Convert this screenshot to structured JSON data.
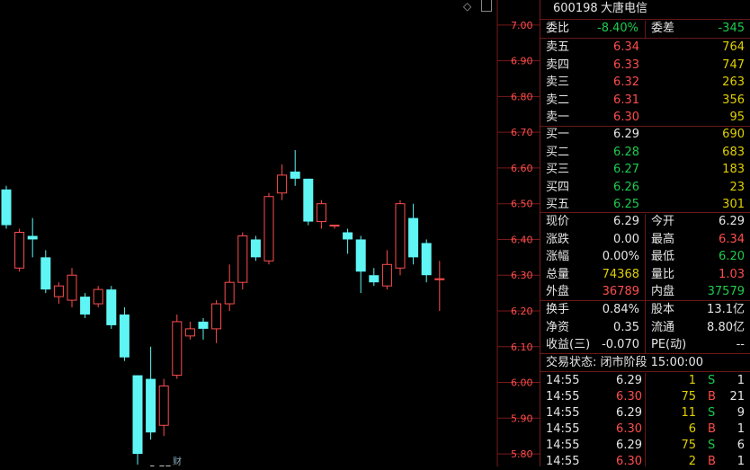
{
  "stock": {
    "code": "600198",
    "name": "大唐电信"
  },
  "ratio": {
    "wb_label": "委比",
    "wb_value": "-8.40%",
    "wc_label": "委差",
    "wc_value": "-345"
  },
  "asks": [
    {
      "label": "卖五",
      "price": "6.34",
      "vol": "764"
    },
    {
      "label": "卖四",
      "price": "6.33",
      "vol": "747"
    },
    {
      "label": "卖三",
      "price": "6.32",
      "vol": "263"
    },
    {
      "label": "卖二",
      "price": "6.31",
      "vol": "356"
    },
    {
      "label": "卖一",
      "price": "6.30",
      "vol": "95"
    }
  ],
  "bids": [
    {
      "label": "买一",
      "price": "6.29",
      "vol": "690"
    },
    {
      "label": "买二",
      "price": "6.28",
      "vol": "683"
    },
    {
      "label": "买三",
      "price": "6.27",
      "vol": "183"
    },
    {
      "label": "买四",
      "price": "6.26",
      "vol": "23"
    },
    {
      "label": "买五",
      "price": "6.25",
      "vol": "301"
    }
  ],
  "quote": [
    {
      "l1": "现价",
      "v1": "6.29",
      "c1": "white",
      "l2": "今开",
      "v2": "6.29",
      "c2": "white"
    },
    {
      "l1": "涨跌",
      "v1": "0.00",
      "c1": "white",
      "l2": "最高",
      "v2": "6.34",
      "c2": "red"
    },
    {
      "l1": "涨幅",
      "v1": "0.00%",
      "c1": "white",
      "l2": "最低",
      "v2": "6.20",
      "c2": "green"
    },
    {
      "l1": "总量",
      "v1": "74368",
      "c1": "yellow",
      "l2": "量比",
      "v2": "1.03",
      "c2": "red"
    },
    {
      "l1": "外盘",
      "v1": "36789",
      "c1": "red",
      "l2": "内盘",
      "v2": "37579",
      "c2": "green"
    }
  ],
  "fund": [
    {
      "l1": "换手",
      "v1": "0.84%",
      "l2": "股本",
      "v2": "13.1亿"
    },
    {
      "l1": "净资",
      "v1": "0.35",
      "l2": "流通",
      "v2": "8.80亿"
    },
    {
      "l1": "收益(三)",
      "v1": "-0.070",
      "l2": "PE(动)",
      "v2": "--"
    }
  ],
  "status": "交易状态: 闭市阶段 15:00:00",
  "ticks": [
    {
      "time": "14:55",
      "price": "6.29",
      "pc": "white",
      "vol": "1",
      "side": "S",
      "count": "1"
    },
    {
      "time": "14:55",
      "price": "6.30",
      "pc": "red",
      "vol": "75",
      "side": "B",
      "count": "21"
    },
    {
      "time": "14:55",
      "price": "6.29",
      "pc": "white",
      "vol": "11",
      "side": "S",
      "count": "9"
    },
    {
      "time": "14:55",
      "price": "6.30",
      "pc": "red",
      "vol": "6",
      "side": "B",
      "count": "1"
    },
    {
      "time": "14:55",
      "price": "6.29",
      "pc": "white",
      "vol": "75",
      "side": "S",
      "count": "6"
    },
    {
      "time": "14:55",
      "price": "6.30",
      "pc": "red",
      "vol": "2",
      "side": "B",
      "count": "1"
    }
  ],
  "chart_data": {
    "type": "candlestick",
    "y_ticks": [
      "7.00",
      "6.90",
      "6.80",
      "6.70",
      "6.60",
      "6.50",
      "6.40",
      "6.30",
      "6.20",
      "6.10",
      "6.00",
      "5.90",
      "5.80"
    ],
    "ylim": [
      5.765,
      7.07
    ],
    "low_annotation": "5.77",
    "bottom_marker": "财",
    "up_color": "#ff4d4d",
    "down_color": "#5ff5f5",
    "candles": [
      {
        "o": 6.54,
        "h": 6.55,
        "l": 6.43,
        "c": 6.44
      },
      {
        "o": 6.32,
        "h": 6.43,
        "l": 6.31,
        "c": 6.42
      },
      {
        "o": 6.41,
        "h": 6.46,
        "l": 6.35,
        "c": 6.4
      },
      {
        "o": 6.35,
        "h": 6.37,
        "l": 6.25,
        "c": 6.26
      },
      {
        "o": 6.24,
        "h": 6.28,
        "l": 6.22,
        "c": 6.27
      },
      {
        "o": 6.23,
        "h": 6.32,
        "l": 6.21,
        "c": 6.3
      },
      {
        "o": 6.24,
        "h": 6.25,
        "l": 6.18,
        "c": 6.19
      },
      {
        "o": 6.22,
        "h": 6.27,
        "l": 6.21,
        "c": 6.26
      },
      {
        "o": 6.26,
        "h": 6.27,
        "l": 6.15,
        "c": 6.16
      },
      {
        "o": 6.19,
        "h": 6.21,
        "l": 6.06,
        "c": 6.07
      },
      {
        "o": 6.02,
        "h": 6.02,
        "l": 5.77,
        "c": 5.8
      },
      {
        "o": 6.01,
        "h": 6.1,
        "l": 5.84,
        "c": 5.86
      },
      {
        "o": 5.88,
        "h": 6.01,
        "l": 5.85,
        "c": 5.99
      },
      {
        "o": 6.02,
        "h": 6.19,
        "l": 6.01,
        "c": 6.17
      },
      {
        "o": 6.13,
        "h": 6.17,
        "l": 6.12,
        "c": 6.15
      },
      {
        "o": 6.17,
        "h": 6.18,
        "l": 6.12,
        "c": 6.15
      },
      {
        "o": 6.15,
        "h": 6.23,
        "l": 6.11,
        "c": 6.22
      },
      {
        "o": 6.22,
        "h": 6.33,
        "l": 6.2,
        "c": 6.28
      },
      {
        "o": 6.28,
        "h": 6.42,
        "l": 6.26,
        "c": 6.41
      },
      {
        "o": 6.4,
        "h": 6.41,
        "l": 6.34,
        "c": 6.35
      },
      {
        "o": 6.34,
        "h": 6.53,
        "l": 6.33,
        "c": 6.52
      },
      {
        "o": 6.53,
        "h": 6.61,
        "l": 6.51,
        "c": 6.58
      },
      {
        "o": 6.59,
        "h": 6.65,
        "l": 6.55,
        "c": 6.57
      },
      {
        "o": 6.57,
        "h": 6.57,
        "l": 6.44,
        "c": 6.45
      },
      {
        "o": 6.45,
        "h": 6.51,
        "l": 6.43,
        "c": 6.5
      },
      {
        "o": 6.44,
        "h": 6.44,
        "l": 6.43,
        "c": 6.44
      },
      {
        "o": 6.42,
        "h": 6.43,
        "l": 6.36,
        "c": 6.4
      },
      {
        "o": 6.4,
        "h": 6.41,
        "l": 6.25,
        "c": 6.31
      },
      {
        "o": 6.3,
        "h": 6.32,
        "l": 6.27,
        "c": 6.28
      },
      {
        "o": 6.27,
        "h": 6.37,
        "l": 6.26,
        "c": 6.33
      },
      {
        "o": 6.32,
        "h": 6.51,
        "l": 6.3,
        "c": 6.5
      },
      {
        "o": 6.46,
        "h": 6.5,
        "l": 6.33,
        "c": 6.35
      },
      {
        "o": 6.39,
        "h": 6.4,
        "l": 6.28,
        "c": 6.3
      },
      {
        "o": 6.29,
        "h": 6.34,
        "l": 6.2,
        "c": 6.29
      }
    ]
  }
}
